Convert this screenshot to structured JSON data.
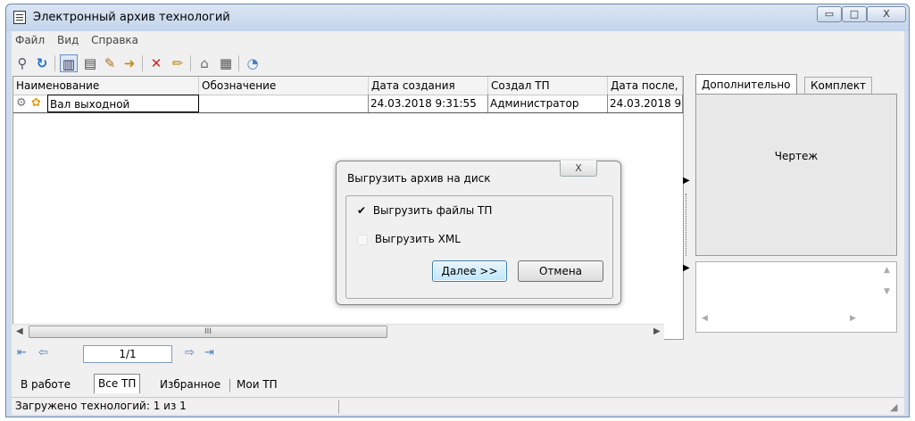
{
  "window": {
    "title": "Электронный архив технологий",
    "minimize_glyph": "▭",
    "maximize_glyph": "□",
    "close_glyph": "X"
  },
  "menu": [
    "Файл",
    "Вид",
    "Справка"
  ],
  "grid": {
    "columns": [
      "Наименование",
      "Обозначение",
      "Дата создания",
      "Создал ТП",
      "Дата после,"
    ],
    "rows": [
      {
        "name": "Вал выходной",
        "designation": "",
        "created": "24.03.2018 9:31:55",
        "author": "Администратор",
        "modified": "24.03.2018 9"
      }
    ],
    "hscroll_mark": "III"
  },
  "pager": {
    "value": "1/1"
  },
  "bottom_tabs": [
    "В работе",
    "Все ТП",
    "Избранное",
    "Мои ТП"
  ],
  "status": {
    "text": "Загружено технологий: 1 из 1"
  },
  "right_panel": {
    "tabs": [
      "Дополнительно",
      "Комплект"
    ],
    "preview_label": "Чертеж"
  },
  "dialog": {
    "title": "Выгрузить архив на диск",
    "close_glyph": "X",
    "option1": "Выгрузить файлы ТП",
    "option1_checked": true,
    "option2": "Выгрузить XML",
    "option2_checked": false,
    "next_label": "Далее >>",
    "cancel_label": "Отмена"
  },
  "colors": {
    "accent": "#3399ff",
    "title_bar": "#cfdcee",
    "close_red": "#c03a2b"
  }
}
